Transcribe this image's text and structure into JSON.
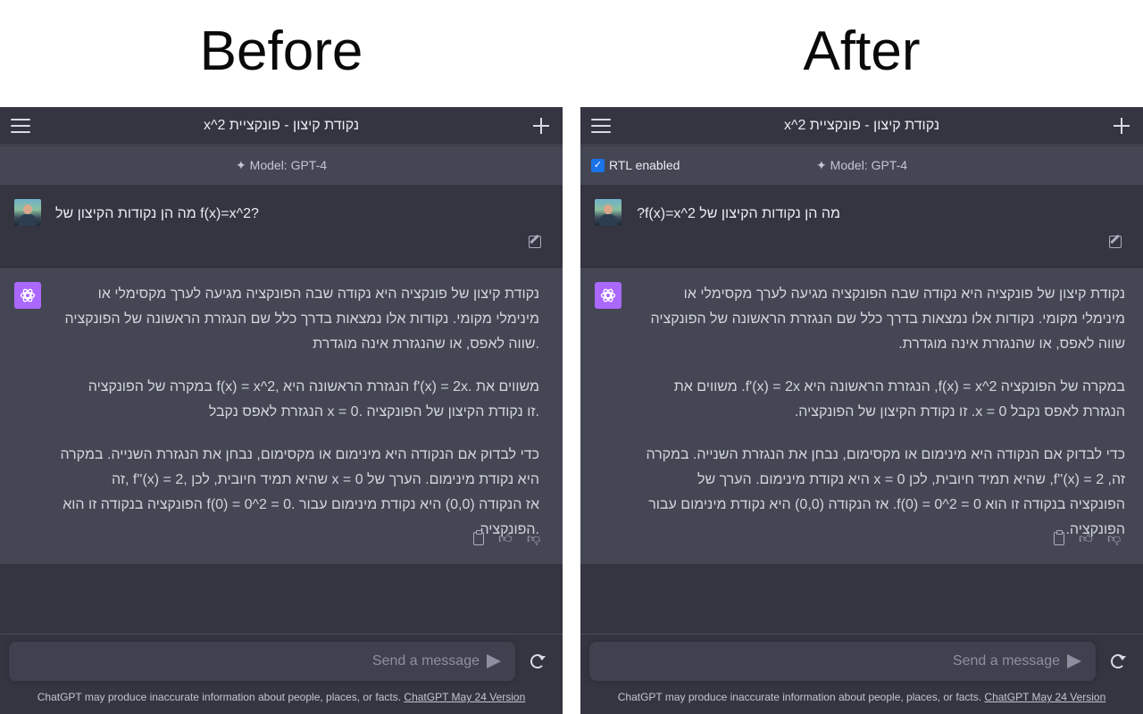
{
  "headings": {
    "before": "Before",
    "after": "After"
  },
  "chat": {
    "title": "x^2 נקודת קיצון - פונקציית",
    "model_label": "Model: GPT-4",
    "rtl_toggle_label": "RTL enabled",
    "user_message_before": "מה הן נקודות הקיצון של f(x)=x^2?",
    "user_message_after": "מה הן נקודות הקיצון של f(x)=x^2?",
    "assistant_paragraphs": [
      "נקודת קיצון של פונקציה היא נקודה שבה הפונקציה מגיעה לערך מקסימלי או מינימלי מקומי. נקודות אלו נמצאות בדרך כלל שם הנגזרת הראשונה של הפונקציה שווה לאפס, או שהנגזרת אינה מוגדרת.",
      "במקרה של הפונקציה f(x) = x^2, הנגזרת הראשונה היא f'(x) = 2x. משווים את הנגזרת לאפס נקבל x = 0. זו נקודת הקיצון של הפונקציה.",
      "כדי לבדוק אם הנקודה היא מינימום או מקסימום, נבחן את הנגזרת השנייה. במקרה זה, f''(x) = 2, שהיא תמיד חיובית, לכן x = 0 היא נקודת מינימום. הערך של הפונקציה בנקודה זו הוא f(0) = 0^2 = 0. אז הנקודה (0,0) היא נקודת מינימום עבור הפונקציה."
    ],
    "input_placeholder": "Send a message",
    "footer_text": "ChatGPT may produce inaccurate information about people, places, or facts. ",
    "footer_link": "ChatGPT May 24 Version"
  },
  "icons": {
    "menu": "hamburger-menu-icon",
    "new_chat": "plus-icon",
    "sparkle": "sparkle-icon",
    "edit": "edit-icon",
    "copy": "clipboard-icon",
    "thumbs_up": "thumbs-up-icon",
    "thumbs_down": "thumbs-down-icon",
    "send": "send-icon",
    "regenerate": "regenerate-icon",
    "assistant_avatar": "openai-logo-icon"
  },
  "colors": {
    "background": "#343541",
    "assistant_row": "#444654",
    "assistant_avatar": "#ab68ff",
    "checkbox": "#1a73e8"
  }
}
